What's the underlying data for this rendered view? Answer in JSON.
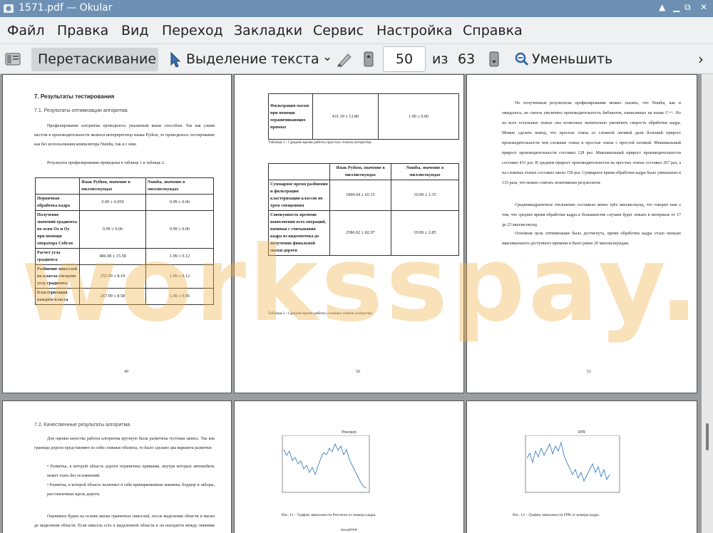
{
  "window": {
    "title": "1571.pdf  — Okular"
  },
  "menu": [
    "Файл",
    "Правка",
    "Вид",
    "Переход",
    "Закладки",
    "Сервис",
    "Настройка",
    "Справка"
  ],
  "toolbar": {
    "browse": "Перетаскивание",
    "text_select": "Выделение текста",
    "page": "50",
    "of": "из",
    "total": "63",
    "zoom_out": "Уменьшить"
  },
  "watermark": "worksspay.ru",
  "p49": {
    "h1": "7. Результаты тестирования",
    "h2": "7.1.   Результаты оптимизации алгоритма",
    "para1": "Профилирование алгоритма проводилось указанным выше способом. Так как узким местом в производительности являлся интерпретатор языка Python, то проводилось тестирование как без использования компилятора Numba, так и с ним.",
    "para2": "Результаты профилирования приведены в таблице 1 и таблице 2.",
    "head": [
      "",
      "Язык Python, значение в миллисекундах",
      "Numba, значение в миллисекундах"
    ],
    "rows": [
      [
        "Первичная обработка кадра",
        "0.99 ± 0.059",
        "0.99 ± 0.06"
      ],
      [
        "Получение значений градиента по осям Ox и Oy при помощи оператора Собеля",
        "0.99 ± 0.06",
        "0.99 ± 0.06"
      ],
      [
        "Расчет угла градиента",
        "486.98 ± 15.58",
        "1.99 ± 0.12"
      ],
      [
        "Разбиение пикселей на классы согласно углу градиента",
        "255.99 ± 8.19",
        "1.99 ± 0.12"
      ],
      [
        "Кластеризация каждого класса",
        "267.99 ± 8.58",
        "1.00 ± 0.06"
      ]
    ],
    "num": "49"
  },
  "p50": {
    "t1row": [
      "Фильтрация маски при помощи ограничивающих прямых",
      "431.39 ± 13.80",
      "1.00 ± 0.06"
    ],
    "cap1": "Таблица 1 - Среднее время работы простых этапов алгоритма.",
    "head": [
      "",
      "Язык Python, значение в миллисекундах",
      "Numba, значение в миллисекундах"
    ],
    "rows": [
      [
        "Суммарное время разбиения и фильтрации кластеризации классов по трем смещениям",
        "1909.94 ± 65.15",
        "10.99 ± 1.35"
      ],
      [
        "Совокупность времени выполнения всех операций, начиная с считывания кадра из видеопотока до получения финальной маски дороги",
        "2586.92 ± 82.97",
        "19.99 ± 2.85"
      ]
    ],
    "cap2": "Таблица 2 - Среднее время работы сложных этапов алгоритма.",
    "num": "50"
  },
  "p51": {
    "para1": "По полученным результатам профилирования можно сказать, что Numba, как и ожидалось, не смогла увеличить производительность библиотек, написанных на языке C++. Но на всех остальных этапах она позволила значительно увеличить скорость обработки кадра. Можно сделать вывод, что простые этапы со сложной логикой дали больший прирост производительности чем сложные этапы и простые этапы с простой логикой. Минимальный прирост производительности составил 128 раз. Максимальный прирост производительности составил 431 раз. В среднем прирост производительности на простых этапах составил 267 раз, а на сложных этапах составил около 150 раз. Суммарное время обработки кадра было уменьшено в 133 раза, что можно считать позитивным результатом.",
    "para2": "Среднеквадратичное отклонение составило менее трёх миллисекунд, что говорит нам о том, что среднее время обработки кадра в большинстве случаев будет лежать в интервале от 17 до 23 миллисекунд.",
    "para3": "Основная цель оптимизации была достигнута, время обработки кадра стало меньше максимального доступного времени и было равно 20 миллисекундам.",
    "num": "51"
  },
  "p52": {
    "h2": "7.2.   Качественные результаты алгоритма",
    "para1": "Для оценки качества работы алгоритма вручную была размечена тестовая запись. Так как границы дороги представляют из себя сложные объекты, то было сделано два варианта разметки:",
    "b1": "Разметка, в которой область дороги ограничена прямыми, внутри которых автомобиль может ехать без осложнений.",
    "b2": "Разметка, в которой область включает в себя припаркованные машины, бордюр и заборы, расставленные вдоль дороги.",
    "para2": "Оценивать будем на основе маски граничных пикселей, после выделения области и маски до выделения области. Если пиксель есть в выделенной области и он находится между линиями разметки, то относим его"
  },
  "p53": {
    "chart_title": "Precision",
    "caption": "Рис. 11 – График зависимости Precision от номера кадра.",
    "chart2_title": "Recall/TPR"
  },
  "p54": {
    "chart_title": "FPR",
    "caption": "Рис. 13 – График зависимости FPR от номера кадра."
  },
  "colors": {
    "titlebar": "#6d90b3",
    "chart_line": "#3e7fbf",
    "watermark": "#f0b24a"
  }
}
